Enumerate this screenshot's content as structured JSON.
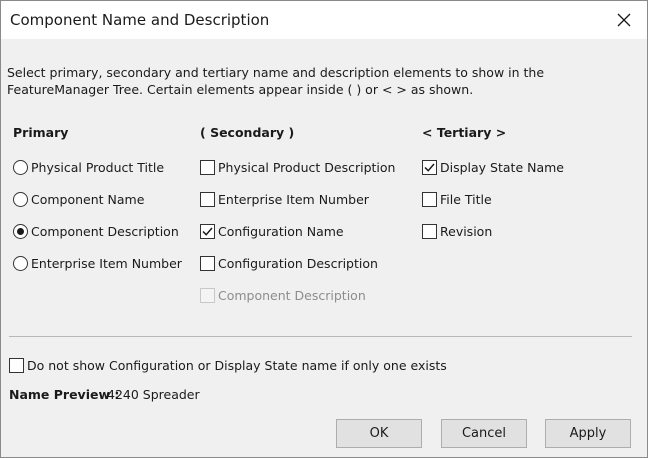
{
  "dialog": {
    "title": "Component Name and Description",
    "instructions": "Select primary, secondary and tertiary name and description elements to show in the FeatureManager Tree. Certain elements appear inside ( ) or < > as shown."
  },
  "primary": {
    "heading": "Primary",
    "options": [
      {
        "label": "Physical Product Title",
        "selected": false
      },
      {
        "label": "Component Name",
        "selected": false
      },
      {
        "label": "Component Description",
        "selected": true
      },
      {
        "label": "Enterprise Item Number",
        "selected": false
      }
    ]
  },
  "secondary": {
    "heading": "( Secondary )",
    "options": [
      {
        "label": "Physical Product Description",
        "checked": false,
        "enabled": true
      },
      {
        "label": "Enterprise Item Number",
        "checked": false,
        "enabled": true
      },
      {
        "label": "Configuration Name",
        "checked": true,
        "enabled": true
      },
      {
        "label": "Configuration Description",
        "checked": false,
        "enabled": true
      },
      {
        "label": "Component Description",
        "checked": false,
        "enabled": false
      }
    ]
  },
  "tertiary": {
    "heading": "< Tertiary >",
    "options": [
      {
        "label": "Display State Name",
        "checked": true
      },
      {
        "label": "File Title",
        "checked": false
      },
      {
        "label": "Revision",
        "checked": false
      }
    ]
  },
  "hide_single": {
    "label": "Do not show Configuration or Display State name if only one exists",
    "checked": false
  },
  "preview": {
    "label": "Name Preview :",
    "value": "4240 Spreader"
  },
  "buttons": {
    "ok": "OK",
    "cancel": "Cancel",
    "apply": "Apply"
  }
}
